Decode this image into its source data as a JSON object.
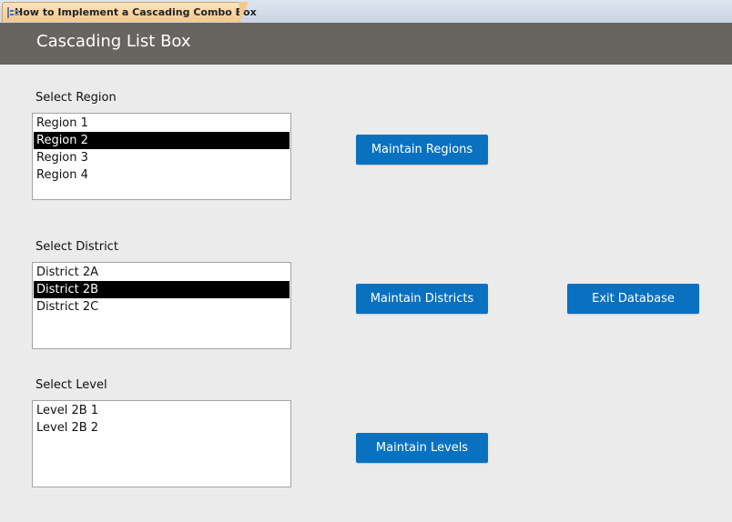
{
  "tab": {
    "title": "How to Implement a Cascading Combo Box",
    "icon": "form-icon"
  },
  "header": {
    "title": "Cascading List Box"
  },
  "regions": {
    "label": "Select Region",
    "items": [
      "Region 1",
      "Region 2",
      "Region 3",
      "Region 4"
    ],
    "selected": "Region 2"
  },
  "districts": {
    "label": "Select District",
    "items": [
      "District 2A",
      "District 2B",
      "District 2C"
    ],
    "selected": "District 2B"
  },
  "levels": {
    "label": "Select Level",
    "items": [
      "Level 2B 1",
      "Level 2B 2"
    ],
    "selected": null
  },
  "buttons": {
    "maintain_regions": "Maintain Regions",
    "maintain_districts": "Maintain Districts",
    "maintain_levels": "Maintain Levels",
    "exit_database": "Exit Database"
  },
  "colors": {
    "button": "#0a71c0",
    "header": "#686560",
    "selection": "#000000",
    "tab": "#f3c98b"
  }
}
